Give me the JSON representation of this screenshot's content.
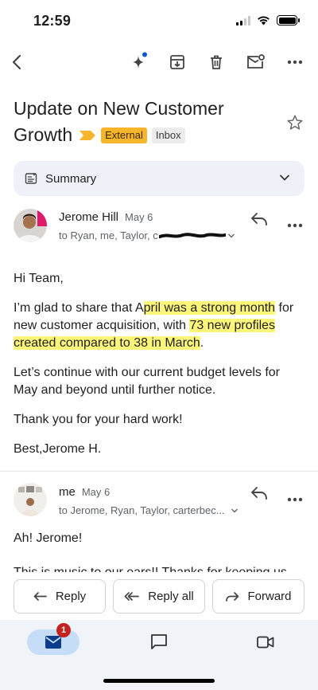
{
  "status_bar": {
    "time": "12:59"
  },
  "subject": {
    "line1": "Update on New Customer",
    "line2": "Growth",
    "labels": [
      "External",
      "Inbox"
    ]
  },
  "summary": {
    "label": "Summary"
  },
  "message1": {
    "sender": "Jerome Hill",
    "date": "May 6",
    "recipients": "to Ryan, me, Taylor, c",
    "greeting": "Hi Team,",
    "p1_a": "I’m glad to share that A",
    "p1_hl1": "pril was a strong month",
    "p1_b": " for new customer acquisition, with ",
    "p1_hl2": "73 new profiles created compared to 38 in March",
    "p1_c": ".",
    "p2": "Let’s continue with our current budget levels for May and beyond until further notice.",
    "p3": "Thank you for your hard work!",
    "signoff": "Best,Jerome H."
  },
  "message2": {
    "sender": "me",
    "date": "May 6",
    "recipients": "to Jerome, Ryan, Taylor, carterbec...",
    "line1": "Ah! Jerome!",
    "line2": "This is music to our ears!! Thanks for keeping us"
  },
  "actions": {
    "reply": "Reply",
    "reply_all": "Reply all",
    "forward": "Forward"
  },
  "bottom_nav": {
    "mail_badge": "1"
  },
  "colors": {
    "accent_blue": "#0b57d0",
    "label_external": "#f7b52b",
    "highlight": "#fbf57a",
    "badge_red": "#c5221f"
  }
}
